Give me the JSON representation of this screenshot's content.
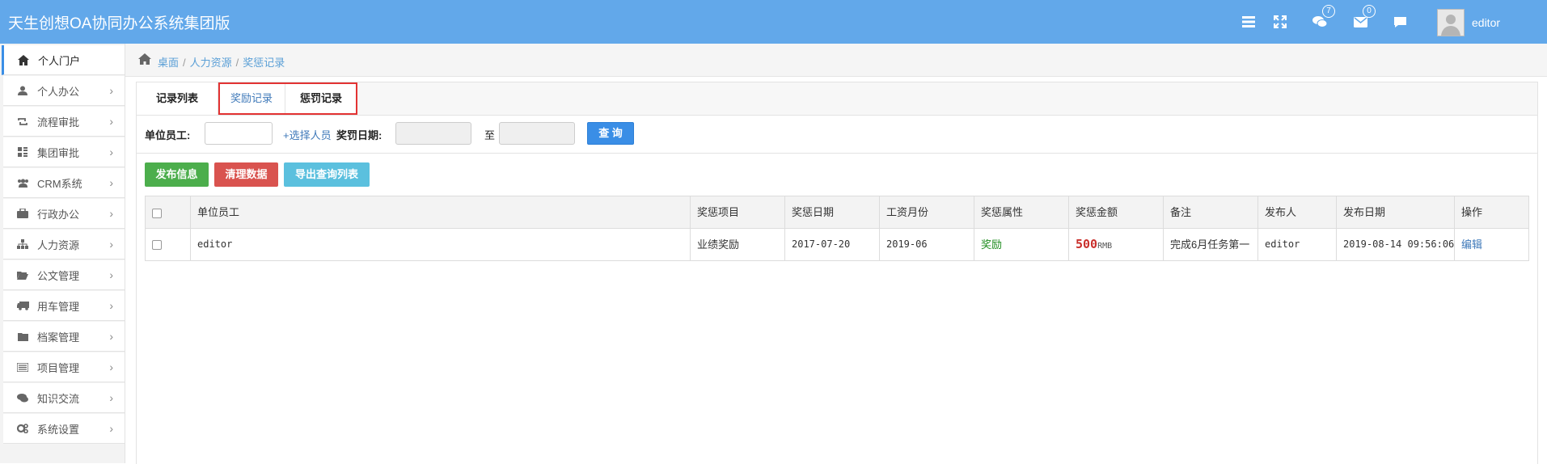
{
  "app": {
    "title": "天生创想OA协同办公系统集团版"
  },
  "header": {
    "badges": {
      "messages": "7",
      "mail": "0"
    },
    "username": "editor",
    "icons": [
      "menu-icon",
      "fullscreen-icon",
      "chat-icon",
      "mail-icon",
      "comment-icon"
    ]
  },
  "sidebar": {
    "items": [
      {
        "label": "个人门户",
        "icon": "home-icon",
        "active": true
      },
      {
        "label": "个人办公",
        "icon": "user-icon"
      },
      {
        "label": "流程审批",
        "icon": "retweet-icon"
      },
      {
        "label": "集团审批",
        "icon": "grid-icon"
      },
      {
        "label": "CRM系统",
        "icon": "users-icon"
      },
      {
        "label": "行政办公",
        "icon": "briefcase-icon"
      },
      {
        "label": "人力资源",
        "icon": "org-chart-icon"
      },
      {
        "label": "公文管理",
        "icon": "folder-open-icon"
      },
      {
        "label": "用车管理",
        "icon": "truck-icon"
      },
      {
        "label": "档案管理",
        "icon": "folder-icon"
      },
      {
        "label": "项目管理",
        "icon": "list-icon"
      },
      {
        "label": "知识交流",
        "icon": "comments-icon"
      },
      {
        "label": "系统设置",
        "icon": "cogs-icon"
      }
    ]
  },
  "breadcrumb": {
    "home": "桌面",
    "section": "人力资源",
    "page": "奖惩记录"
  },
  "tabs": {
    "list": "记录列表",
    "reward": "奖励记录",
    "penalty": "惩罚记录"
  },
  "filter": {
    "employee_label": "单位员工:",
    "select_link": "+选择人员",
    "date_label": "奖罚日期:",
    "to_label": "至",
    "query_button": "查 询"
  },
  "actions": {
    "publish": "发布信息",
    "clear": "清理数据",
    "export": "导出查询列表"
  },
  "table": {
    "columns": [
      "单位员工",
      "奖惩项目",
      "奖惩日期",
      "工资月份",
      "奖惩属性",
      "奖惩金额",
      "备注",
      "发布人",
      "发布日期",
      "操作"
    ],
    "rows": [
      {
        "employee": "editor",
        "item": "业绩奖励",
        "date": "2017-07-20",
        "salary_month": "2019-06",
        "attribute": "奖励",
        "amount": "500",
        "amount_unit": "RMB",
        "note": "完成6月任务第一",
        "publisher": "editor",
        "publish_date": "2019-08-14 09:56:06",
        "action": "编辑"
      }
    ]
  },
  "colors": {
    "header": "#62a8ea",
    "accent": "#3a8ee6",
    "green": "#4cae4c",
    "red": "#d9534f",
    "cyan": "#5bc0de"
  }
}
